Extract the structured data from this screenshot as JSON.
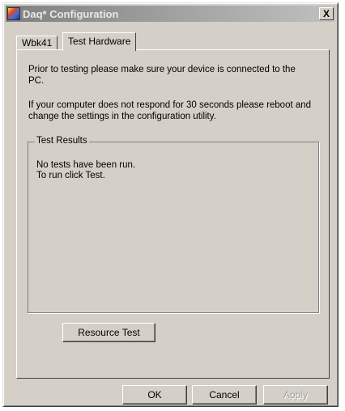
{
  "window": {
    "title": "Daq* Configuration",
    "close_label": "X"
  },
  "tabs": [
    {
      "label": "Wbk41",
      "active": false
    },
    {
      "label": "Test Hardware",
      "active": true
    }
  ],
  "panel": {
    "instruction_1": "Prior to testing please make sure your device is connected to the PC.",
    "instruction_2": "If your computer does not respond for 30 seconds please reboot and change the settings in the configuration utility.",
    "test_results": {
      "legend": "Test Results",
      "line_1": "No tests have been run.",
      "line_2": "To run click Test."
    },
    "resource_test_label": "Resource Test"
  },
  "footer": {
    "ok_label": "OK",
    "cancel_label": "Cancel",
    "apply_label": "Apply"
  }
}
